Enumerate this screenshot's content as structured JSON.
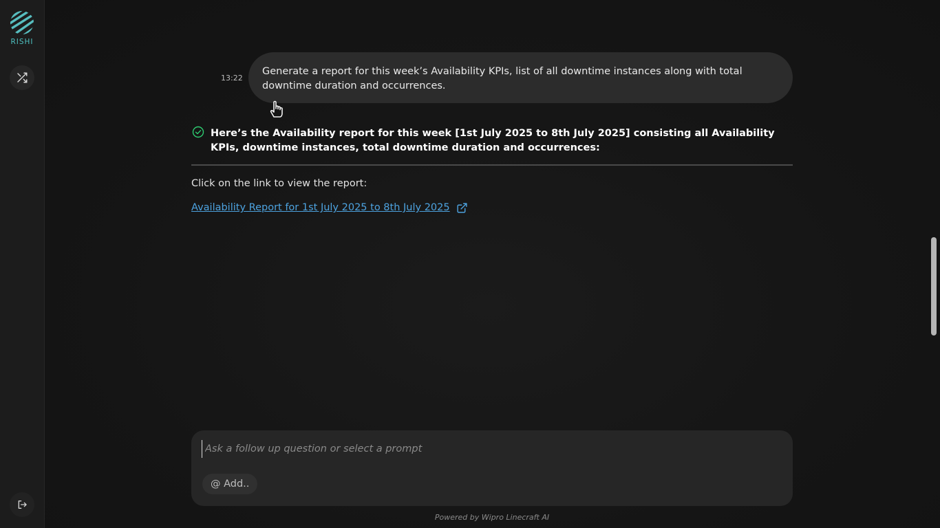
{
  "brand": {
    "name": "RISHI",
    "accent": "#4fc3c3"
  },
  "sidebar": {
    "shuffle_icon": "shuffle-icon",
    "logout_icon": "logout-icon"
  },
  "conversation": {
    "user_message": {
      "time": "13:22",
      "text": "Generate a report for this week’s Availability KPIs, list of all downtime instances along with total downtime duration and occurrences."
    },
    "assistant": {
      "status_icon": "check-circle-icon",
      "status_color": "#2ecc71",
      "title": "Here’s the Availability report for this week [1st July 2025 to 8th July 2025] consisting all Availability KPIs, downtime instances, total downtime duration and occurrences:",
      "hint": "Click on the link to view the report:",
      "link_text": "Availability Report for 1st July 2025 to 8th July 2025",
      "link_color": "#4da3e0"
    }
  },
  "composer": {
    "placeholder": "Ask a follow up question or select a prompt",
    "value": "",
    "add_label": "@ Add.."
  },
  "footer": {
    "text": "Powered by Wipro Linecraft AI"
  }
}
